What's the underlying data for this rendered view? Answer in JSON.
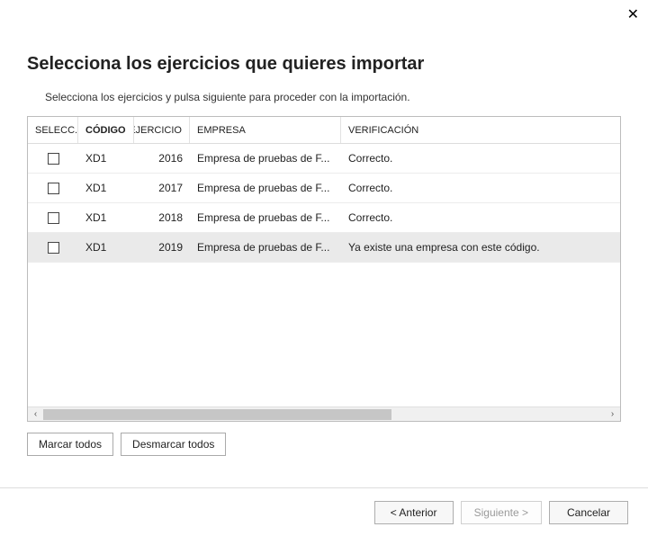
{
  "close_label": "✕",
  "title": "Selecciona los ejercicios que quieres importar",
  "subtitle": "Selecciona los ejercicios y pulsa siguiente para proceder con la importación.",
  "columns": {
    "seleccionar": "SELECC...",
    "codigo": "CÓDIGO",
    "ejercicio": "EJERCICIO",
    "empresa": "EMPRESA",
    "verificacion": "VERIFICACIÓN"
  },
  "rows": [
    {
      "codigo": "XD1",
      "ejercicio": "2016",
      "empresa": "Empresa de pruebas de F...",
      "verificacion": "Correcto."
    },
    {
      "codigo": "XD1",
      "ejercicio": "2017",
      "empresa": "Empresa de pruebas de F...",
      "verificacion": "Correcto."
    },
    {
      "codigo": "XD1",
      "ejercicio": "2018",
      "empresa": "Empresa de pruebas de F...",
      "verificacion": "Correcto."
    },
    {
      "codigo": "XD1",
      "ejercicio": "2019",
      "empresa": "Empresa de pruebas de F...",
      "verificacion": "Ya existe una empresa con este código."
    }
  ],
  "buttons": {
    "mark_all": "Marcar todos",
    "unmark_all": "Desmarcar todos"
  },
  "footer": {
    "previous": "<  Anterior",
    "next": "Siguiente  >",
    "cancel": "Cancelar"
  },
  "scroll": {
    "left": "‹",
    "right": "›"
  }
}
